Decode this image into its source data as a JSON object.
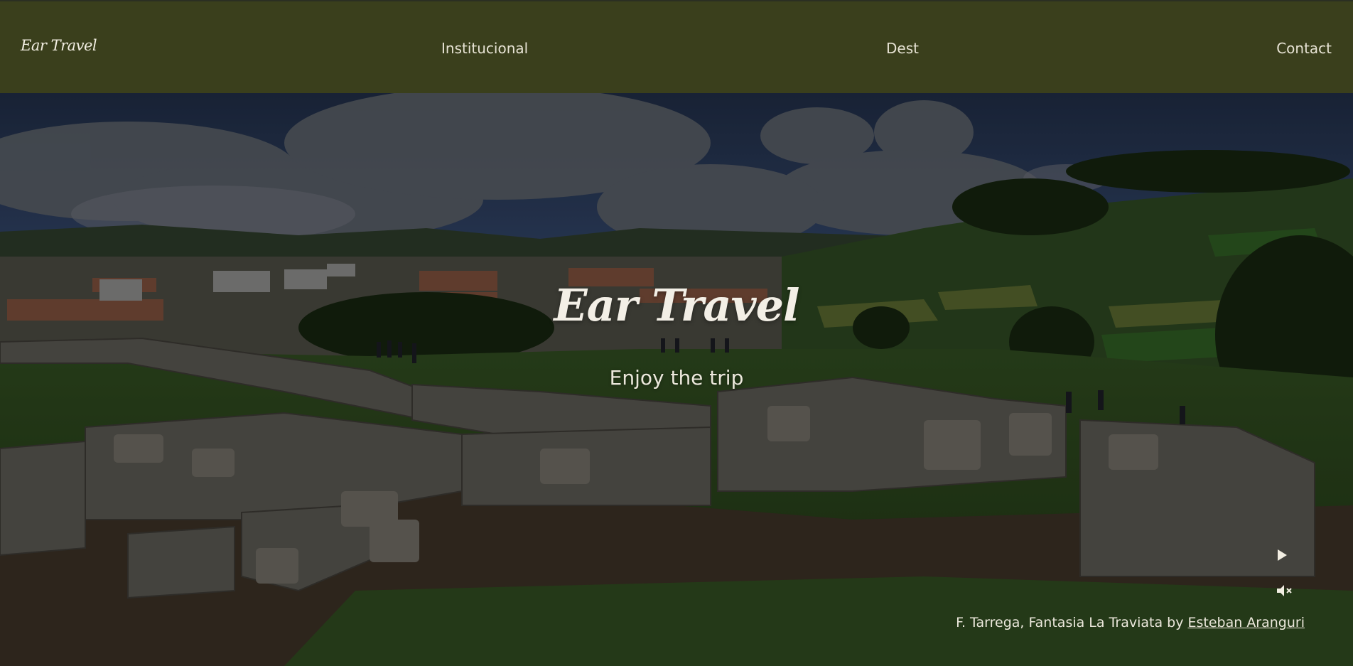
{
  "header": {
    "logo": "Ear Travel",
    "nav": [
      {
        "label": "Institucional"
      },
      {
        "label": "Dest"
      },
      {
        "label": "Contact"
      }
    ]
  },
  "hero": {
    "title": "Ear Travel",
    "subtitle": "Enjoy the trip",
    "credit": {
      "text": "F. Tarrega, Fantasia La Traviata by ",
      "link": "Esteban Aranguri"
    },
    "controls": {
      "play_icon": "play-icon",
      "mute_icon": "speaker-muted-icon"
    }
  },
  "colors": {
    "header_bg": "#3a3f1c",
    "text": "#f3efe6"
  }
}
